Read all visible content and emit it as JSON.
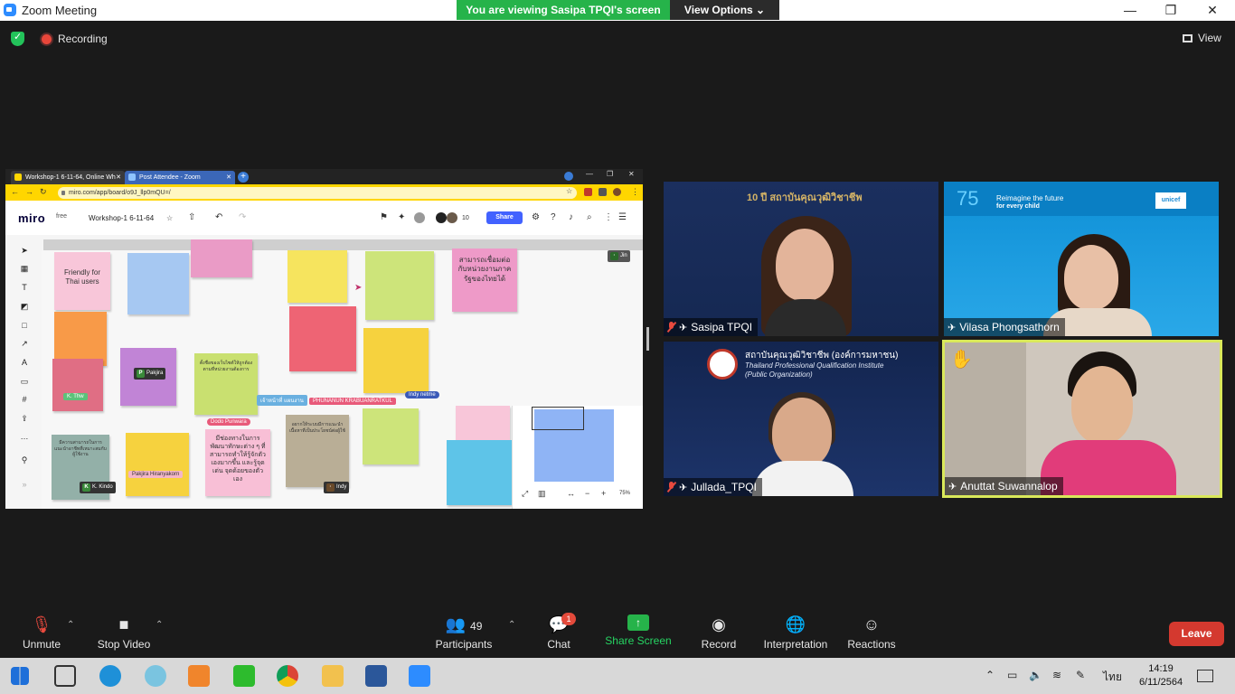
{
  "window": {
    "title": "Zoom Meeting",
    "minimize": "—",
    "restore": "❐",
    "close": "✕"
  },
  "banner": {
    "viewing": "You are viewing Sasipa TPQI's screen",
    "view_options": "View Options ⌄"
  },
  "topbar": {
    "recording": "Recording",
    "view": "View"
  },
  "shared_screen": {
    "tabs": [
      {
        "label": "Workshop-1 6-11-64, Online Wh",
        "close": "✕"
      },
      {
        "label": "Post Attendee - Zoom",
        "close": "✕"
      }
    ],
    "new_tab": "+",
    "url": "miro.com/app/board/o9J_llp0mQU=/",
    "miro": {
      "logo": "miro",
      "plan": "free",
      "board_name": "Workshop-1 6-11-64",
      "share": "Share",
      "participants_count": "10"
    },
    "notes": [
      {
        "text": "Friendly for Thai users"
      },
      {
        "text": "สามารถเชื่อมต่อกับหน่วยงานภาครัฐของไทยได้"
      },
      {
        "text": "ตั้งชื่อของเว็บไซต์ให้ถูกต้องตามที่หน่วยงานต้องการ"
      },
      {
        "text": "มีช่องทางในการพัฒนาทักษะต่าง ๆ ที่สามารถทำให้รู้จักตัวเองมากขึ้น และรู้จุดเด่น จุดด้อยของตัวเอง"
      },
      {
        "text": "มีความสามารถในการแนะนำอาชีพที่เหมาะสมกับผู้ใช้งาน"
      },
      {
        "text": "อยากให้ระบบมีการแนะนำเนื้อหาที่เป็นประโยชน์ต่อผู้ใช้"
      }
    ],
    "name_tags": [
      {
        "name": "Pakjira"
      },
      {
        "name": "K. Thw"
      },
      {
        "name": "เจ้าหน้าที่ แผนงาน"
      },
      {
        "name": "PHUNANUN KRABUANRATKUL"
      },
      {
        "name": "Indy netme"
      },
      {
        "name": "Dodo Punwara"
      },
      {
        "name": "Pakjira Hiranyakorn"
      },
      {
        "name": "K. Kindo"
      },
      {
        "name": "Indy"
      },
      {
        "name": "Jin"
      }
    ],
    "zoom_level": "75%"
  },
  "participants_tiles": [
    {
      "name": "Sasipa TPQI",
      "muted": true,
      "backdrop": "10 ปี สถาบันคุณวุฒิวิชาชีพ"
    },
    {
      "name": "Vilasa Phongsathorn",
      "muted": false,
      "backdrop_line1": "Reimagine the future",
      "backdrop_line2": "for every child",
      "backdrop_number": "75",
      "backdrop_brand": "unicef"
    },
    {
      "name": "Jullada_TPQI",
      "muted": true,
      "backdrop_line1": "สถาบันคุณวุฒิวิชาชีพ (องค์การมหาชน)",
      "backdrop_line2": "Thailand Professional Qualification Institute",
      "backdrop_line3": "(Public Organization)"
    },
    {
      "name": "Anuttat Suwannalop",
      "muted": false,
      "raised_hand": true
    }
  ],
  "controls": {
    "unmute": "Unmute",
    "stop_video": "Stop Video",
    "participants": "Participants",
    "participants_count": "49",
    "chat": "Chat",
    "chat_badge": "1",
    "share_screen": "Share Screen",
    "record": "Record",
    "interpretation": "Interpretation",
    "reactions": "Reactions",
    "leave": "Leave"
  },
  "taskbar": {
    "language": "ไทย",
    "time": "14:19",
    "date": "6/11/2564"
  },
  "colors": {
    "banner_green": "#26b34a",
    "leave_red": "#d4392f",
    "speaker_border": "#d9e85a",
    "miro_yellow": "#ffd600"
  }
}
